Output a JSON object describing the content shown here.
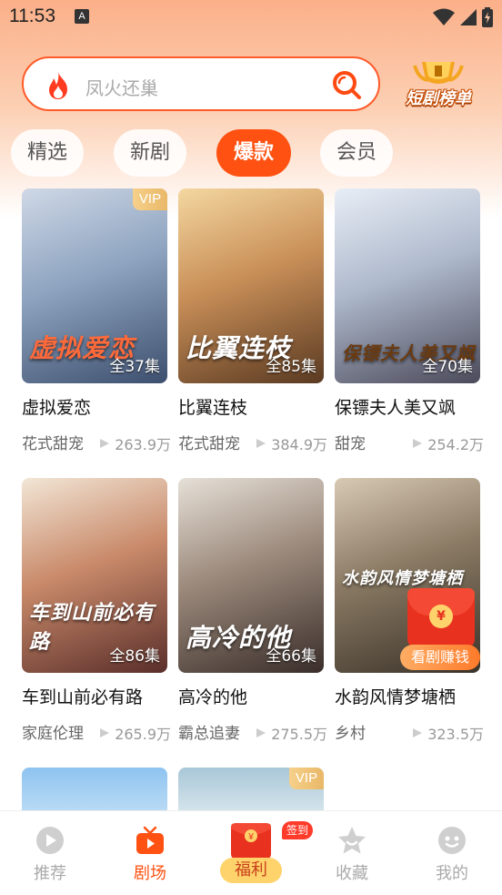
{
  "status_bar": {
    "time": "11:53",
    "notif_icon": "A"
  },
  "search": {
    "placeholder": "凤火还巢"
  },
  "rank_badge": {
    "label": "短剧榜单"
  },
  "tabs": [
    {
      "label": "精选",
      "active": false
    },
    {
      "label": "新剧",
      "active": false
    },
    {
      "label": "爆款",
      "active": true
    },
    {
      "label": "会员",
      "active": false
    }
  ],
  "dramas": [
    {
      "title": "虚拟爱恋",
      "poster_text": "虚拟爱恋",
      "episodes": "全37集",
      "tag": "花式甜宠",
      "views": "263.9万",
      "vip": "VIP"
    },
    {
      "title": "比翼连枝",
      "poster_text": "比翼连枝",
      "episodes": "全85集",
      "tag": "花式甜宠",
      "views": "384.9万",
      "vip": ""
    },
    {
      "title": "保镖夫人美又飒",
      "poster_text": "保镖夫人美又飒",
      "episodes": "全70集",
      "tag": "甜宠",
      "views": "254.2万",
      "vip": ""
    },
    {
      "title": "车到山前必有路",
      "poster_text": "车到山前必有路",
      "episodes": "全86集",
      "tag": "家庭伦理",
      "views": "265.9万",
      "vip": ""
    },
    {
      "title": "高冷的他",
      "poster_text": "高冷的他",
      "episodes": "全66集",
      "tag": "霸总追妻",
      "views": "275.5万",
      "vip": ""
    },
    {
      "title": "水韵风情梦塘栖",
      "poster_text": "水韵风情梦塘栖",
      "episodes": "",
      "tag": "乡村",
      "views": "323.5万",
      "vip": ""
    },
    {
      "title": "",
      "poster_text": "",
      "episodes": "",
      "tag": "",
      "views": "",
      "vip": ""
    },
    {
      "title": "",
      "poster_text": "",
      "episodes": "",
      "tag": "",
      "views": "",
      "vip": "VIP"
    }
  ],
  "float_envelope": {
    "coin": "¥",
    "label": "看剧赚钱"
  },
  "bottom_nav": {
    "items": [
      {
        "label": "推荐",
        "icon": "play-icon",
        "active": false
      },
      {
        "label": "剧场",
        "icon": "tv-icon",
        "active": true
      },
      {
        "label": "福利",
        "icon": "red-envelope-icon",
        "active": false
      },
      {
        "label": "收藏",
        "icon": "star-icon",
        "active": false
      },
      {
        "label": "我的",
        "icon": "profile-icon",
        "active": false
      }
    ],
    "signin_badge": "签到"
  },
  "colors": {
    "accent": "#ff5212",
    "tab_active_bg": "#ff5212",
    "vip_gold": "#e9b868"
  }
}
